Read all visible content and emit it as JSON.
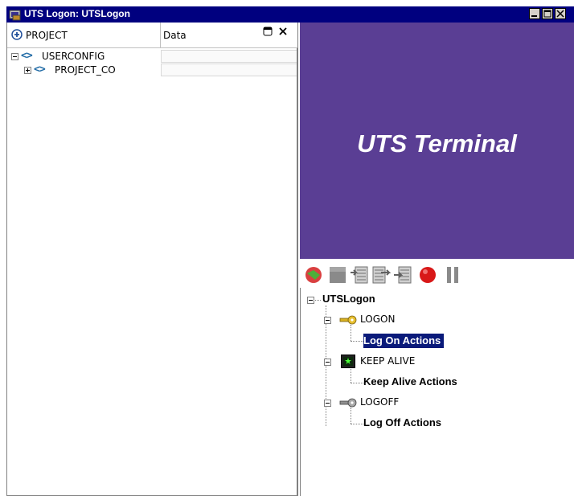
{
  "window": {
    "title": "UTS Logon: UTSLogon",
    "icon": "app-icon"
  },
  "project_pane": {
    "col_project": "PROJECT",
    "col_data": "Data",
    "tree": [
      {
        "label": "USERCONFIG",
        "expanded": true,
        "icon": "xml-icon"
      },
      {
        "label": "PROJECT_CO",
        "expanded": false,
        "icon": "xml-icon"
      }
    ]
  },
  "terminal": {
    "label": "UTS Terminal",
    "color": "#5a3e94"
  },
  "toolbar": {
    "buttons": [
      "record-icon",
      "stop-icon",
      "step-icon",
      "step-over-icon",
      "step-into-icon",
      "breakpoint-icon",
      "pause-icon"
    ]
  },
  "actions_tree": {
    "root": "UTSLogon",
    "nodes": [
      {
        "label": "LOGON",
        "icon": "key-icon",
        "child": "Log On Actions",
        "selected": true
      },
      {
        "label": "KEEP ALIVE",
        "icon": "keepalive-icon",
        "child": "Keep Alive Actions",
        "selected": false
      },
      {
        "label": "LOGOFF",
        "icon": "key-gray-icon",
        "child": "Log Off Actions",
        "selected": false
      }
    ]
  },
  "colors": {
    "titlebar": "#00007f",
    "selection": "#0a1a7a",
    "xml_accent": "#1f6aa5"
  }
}
